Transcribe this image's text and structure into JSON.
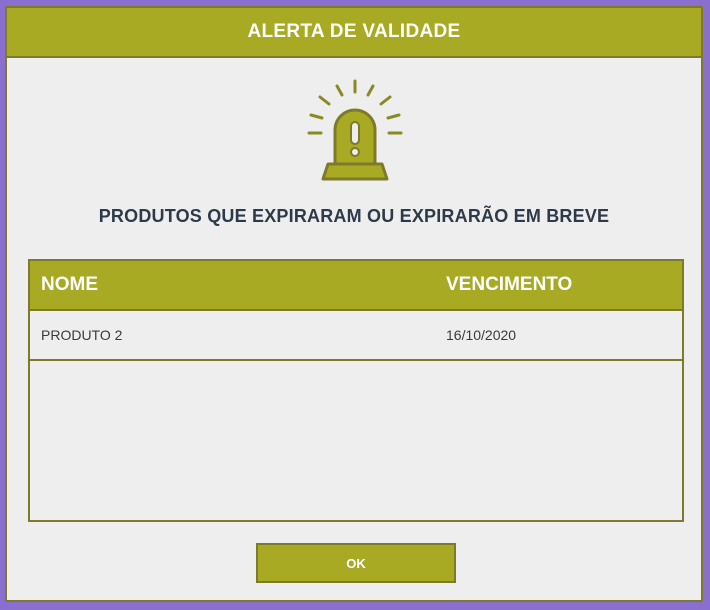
{
  "dialog": {
    "title": "ALERTA DE VALIDADE",
    "icon": "siren-alarm-icon",
    "subtitle": "PRODUTOS QUE EXPIRARAM OU EXPIRARÃO EM BREVE",
    "ok_label": "OK"
  },
  "table": {
    "columns": [
      "NOME",
      "VENCIMENTO"
    ],
    "rows": [
      {
        "nome": "PRODUTO 2",
        "vencimento": "16/10/2020"
      }
    ]
  },
  "colors": {
    "accent": "#a8aa24",
    "border": "#7d7a2a",
    "background": "#eeeeee",
    "window_background": "#8a6fd0",
    "heading_text": "#2c3a4a"
  }
}
